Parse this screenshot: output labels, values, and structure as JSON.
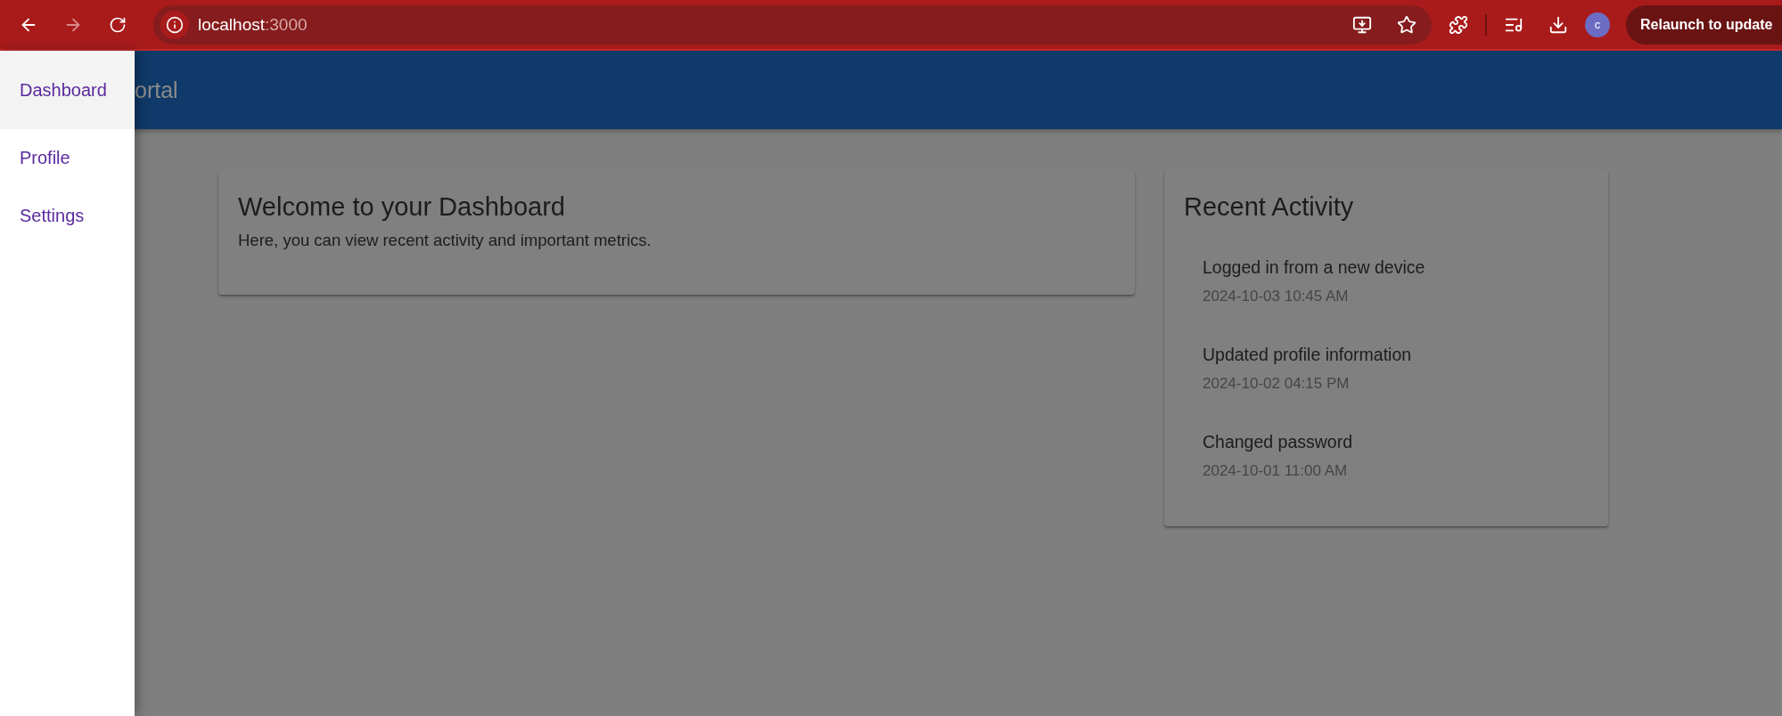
{
  "browser": {
    "url_host": "localhost",
    "url_port": ":3000",
    "forward_disabled": true,
    "profile_initial": "c",
    "relaunch_label": "Relaunch to update"
  },
  "app_bar": {
    "title": "ortal"
  },
  "drawer": {
    "items": [
      {
        "label": "Dashboard",
        "selected": true
      },
      {
        "label": "Profile",
        "selected": false
      },
      {
        "label": "Settings",
        "selected": false
      }
    ]
  },
  "welcome_card": {
    "title": "Welcome to your Dashboard",
    "text": "Here, you can view recent activity and important metrics."
  },
  "activity_card": {
    "title": "Recent Activity",
    "items": [
      {
        "text": "Logged in from a new device",
        "time": "2024-10-03 10:45 AM"
      },
      {
        "text": "Updated profile information",
        "time": "2024-10-02 04:15 PM"
      },
      {
        "text": "Changed password",
        "time": "2024-10-01 11:00 AM"
      }
    ]
  }
}
